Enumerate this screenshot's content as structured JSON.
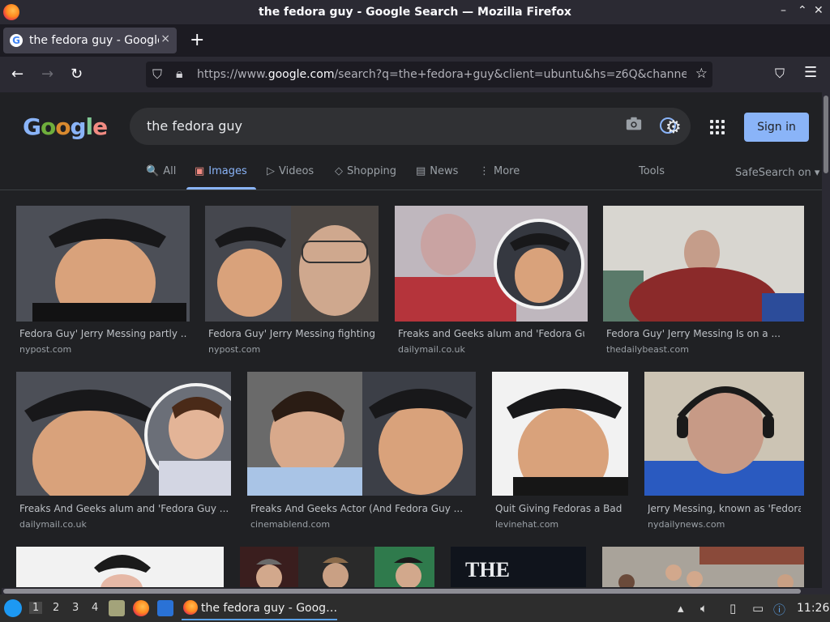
{
  "window": {
    "title": "the fedora guy - Google Search — Mozilla Firefox",
    "controls": [
      "–",
      "⌃",
      "✕"
    ]
  },
  "tab": {
    "title": "the fedora guy - Google",
    "close": "×"
  },
  "new_tab": "+",
  "urlbar": {
    "url_pre": "https://www.",
    "url_host": "google.com",
    "url_post": "/search?q=the+fedora+guy&client=ubuntu&hs=z6Q&channe"
  },
  "google": {
    "logo_letters": [
      "G",
      "o",
      "o",
      "g",
      "l",
      "e"
    ],
    "query": "the fedora guy",
    "signin": "Sign in",
    "tabs": [
      {
        "label": "All",
        "icon": "🔍"
      },
      {
        "label": "Images",
        "icon": "▣"
      },
      {
        "label": "Videos",
        "icon": "▷"
      },
      {
        "label": "Shopping",
        "icon": "◇"
      },
      {
        "label": "News",
        "icon": "▤"
      },
      {
        "label": "More",
        "icon": "⋮"
      }
    ],
    "tools": "Tools",
    "safesearch": "SafeSearch on"
  },
  "results": [
    {
      "caption": "Fedora Guy' Jerry Messing partly ...",
      "source": "nypost.com"
    },
    {
      "caption": "Fedora Guy' Jerry Messing fighting ...",
      "source": "nypost.com"
    },
    {
      "caption": "Freaks and Geeks alum and 'Fedora Guy...",
      "source": "dailymail.co.uk"
    },
    {
      "caption": "Fedora Guy' Jerry Messing Is on a ...",
      "source": "thedailybeast.com"
    },
    {
      "caption": "Freaks And Geeks alum and 'Fedora Guy ...",
      "source": "dailymail.co.uk"
    },
    {
      "caption": "Freaks And Geeks Actor (And Fedora Guy ...",
      "source": "cinemablend.com"
    },
    {
      "caption": "Quit Giving Fedoras a Bad ...",
      "source": "levinehat.com"
    },
    {
      "caption": "Jerry Messing, known as 'Fedora...",
      "source": "nydailynews.com"
    },
    {
      "caption": "",
      "source": ""
    },
    {
      "caption": "",
      "source": ""
    },
    {
      "caption": "",
      "source": ""
    },
    {
      "caption": "",
      "source": ""
    }
  ],
  "third_row_text": "THE",
  "taskbar": {
    "workspaces": [
      "1",
      "2",
      "3",
      "4"
    ],
    "task_title": "the fedora guy - Goog…",
    "clock": "11:26"
  },
  "colors": {
    "accent": "#8ab4f8",
    "background": "#202124",
    "chrome": "#2b2a33"
  }
}
